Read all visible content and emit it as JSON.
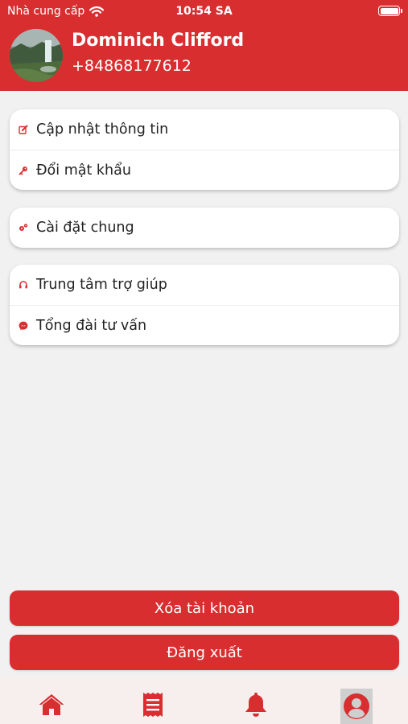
{
  "status_bar": {
    "carrier": "Nhà cung cấp",
    "time": "10:54 SA"
  },
  "profile": {
    "name": "Dominich Clifford",
    "phone": "+84868177612"
  },
  "menu_groups": [
    [
      {
        "label": "Cập nhật thông tin",
        "icon": "edit-icon"
      },
      {
        "label": "Đổi mật khẩu",
        "icon": "key-icon"
      }
    ],
    [
      {
        "label": "Cài đặt chung",
        "icon": "gears-icon"
      }
    ],
    [
      {
        "label": "Trung tâm trợ giúp",
        "icon": "headset-icon"
      },
      {
        "label": "Tổng đài tư vấn",
        "icon": "messenger-icon"
      }
    ]
  ],
  "buttons": {
    "delete_account": "Xóa tài khoản",
    "logout": "Đăng xuất"
  },
  "tabs": [
    {
      "icon": "home-icon",
      "active": false
    },
    {
      "icon": "receipt-icon",
      "active": false
    },
    {
      "icon": "bell-icon",
      "active": false
    },
    {
      "icon": "user-circle-icon",
      "active": true
    }
  ],
  "colors": {
    "brand": "#d92e30",
    "background": "#f1f1f1",
    "tabbar": "#f7eeee"
  }
}
